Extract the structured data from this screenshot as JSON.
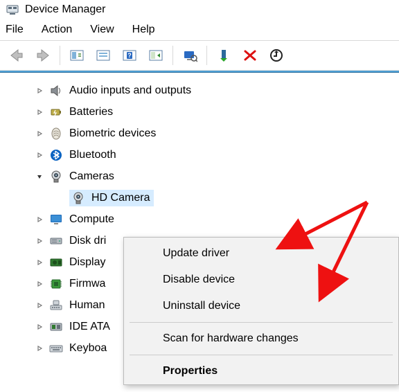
{
  "window": {
    "title": "Device Manager"
  },
  "menu": {
    "items": [
      "File",
      "Action",
      "View",
      "Help"
    ]
  },
  "tree": {
    "items": [
      {
        "label": "Audio inputs and outputs",
        "expanded": false,
        "icon": "speaker"
      },
      {
        "label": "Batteries",
        "expanded": false,
        "icon": "battery"
      },
      {
        "label": "Biometric devices",
        "expanded": false,
        "icon": "fingerprint"
      },
      {
        "label": "Bluetooth",
        "expanded": false,
        "icon": "bluetooth"
      },
      {
        "label": "Cameras",
        "expanded": true,
        "icon": "camera",
        "children": [
          {
            "label": "HD Camera",
            "icon": "camera",
            "selected": true
          }
        ]
      },
      {
        "label": "Computer",
        "expanded": false,
        "icon": "monitor",
        "truncated": "Compute"
      },
      {
        "label": "Disk drives",
        "expanded": false,
        "icon": "drive",
        "truncated": "Disk dri"
      },
      {
        "label": "Display adapters",
        "expanded": false,
        "icon": "gpu",
        "truncated": "Display"
      },
      {
        "label": "Firmware",
        "expanded": false,
        "icon": "chip",
        "truncated": "Firmwa"
      },
      {
        "label": "Human Interface Devices",
        "expanded": false,
        "icon": "hid",
        "truncated": "Human"
      },
      {
        "label": "IDE ATA/ATAPI controllers",
        "expanded": false,
        "icon": "ide",
        "truncated": "IDE ATA"
      },
      {
        "label": "Keyboards",
        "expanded": false,
        "icon": "keyboard",
        "truncated": "Keyboa"
      }
    ]
  },
  "context_menu": {
    "items": [
      {
        "label": "Update driver",
        "bold": false
      },
      {
        "label": "Disable device",
        "bold": false
      },
      {
        "label": "Uninstall device",
        "bold": false
      },
      {
        "sep": true
      },
      {
        "label": "Scan for hardware changes",
        "bold": false
      },
      {
        "sep": true
      },
      {
        "label": "Properties",
        "bold": true
      }
    ]
  }
}
